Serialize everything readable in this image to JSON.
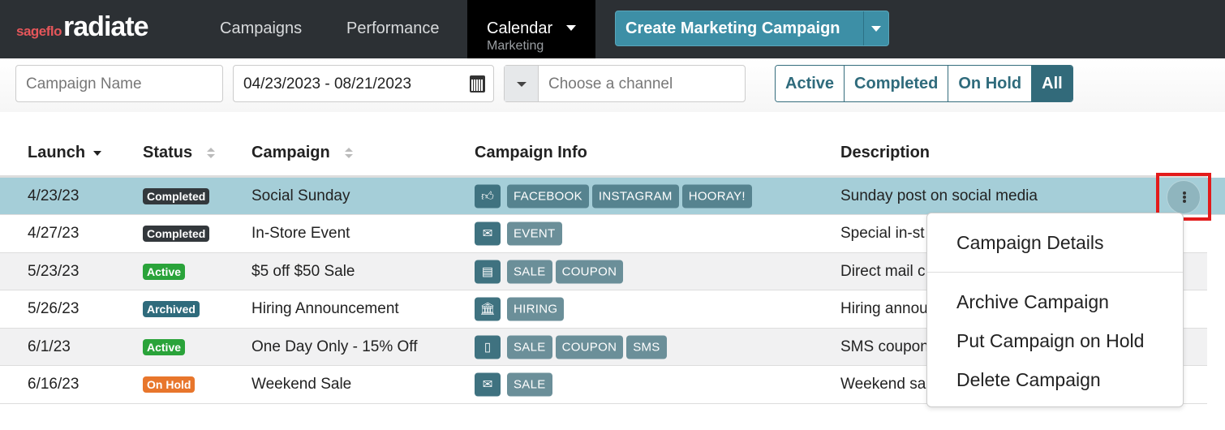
{
  "nav": {
    "logo_small": "sageflo",
    "logo_big": "radiate",
    "links": [
      "Campaigns",
      "Performance"
    ],
    "calendar": "Calendar",
    "calendar_sub": "Marketing",
    "create": "Create Marketing Campaign"
  },
  "filters": {
    "name_placeholder": "Campaign Name",
    "date_range": "04/23/2023 - 08/21/2023",
    "channel_placeholder": "Choose a channel",
    "status_buttons": [
      "Active",
      "Completed",
      "On Hold",
      "All"
    ],
    "selected_status": "All"
  },
  "table": {
    "headers": [
      "Launch",
      "Status",
      "Campaign",
      "Campaign Info",
      "Description"
    ],
    "rows": [
      {
        "launch": "4/23/23",
        "status": "Completed",
        "campaign": "Social Sunday",
        "icon": "thumbs-up",
        "tags": [
          "FACEBOOK",
          "INSTAGRAM",
          "HOORAY!"
        ],
        "description": "Sunday post on social media"
      },
      {
        "launch": "4/27/23",
        "status": "Completed",
        "campaign": "In-Store Event",
        "icon": "envelope",
        "tags": [
          "EVENT"
        ],
        "description": "Special in-st"
      },
      {
        "launch": "5/23/23",
        "status": "Active",
        "campaign": "$5 off $50 Sale",
        "icon": "newspaper",
        "tags": [
          "SALE",
          "COUPON"
        ],
        "description": "Direct mail c"
      },
      {
        "launch": "5/26/23",
        "status": "Archived",
        "campaign": "Hiring Announcement",
        "icon": "bank",
        "tags": [
          "HIRING"
        ],
        "description": "Hiring annou"
      },
      {
        "launch": "6/1/23",
        "status": "Active",
        "campaign": "One Day Only - 15% Off",
        "icon": "sms-phone",
        "tags": [
          "SALE",
          "COUPON",
          "SMS"
        ],
        "description": "SMS coupon"
      },
      {
        "launch": "6/16/23",
        "status": "On Hold",
        "campaign": "Weekend Sale",
        "icon": "envelope",
        "tags": [
          "SALE"
        ],
        "description": "Weekend sa"
      }
    ]
  },
  "menu": {
    "items": [
      "Campaign Details",
      "Archive Campaign",
      "Put Campaign on Hold",
      "Delete Campaign"
    ]
  }
}
